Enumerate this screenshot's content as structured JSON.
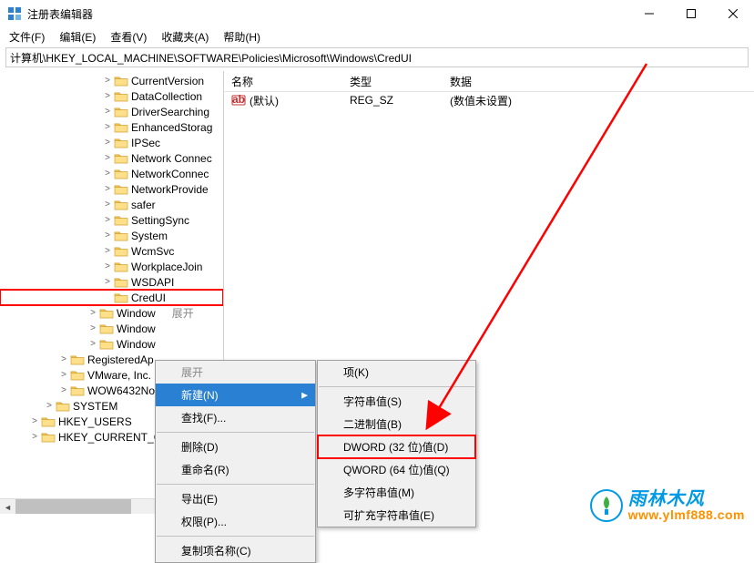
{
  "window": {
    "title": "注册表编辑器",
    "controls": {
      "min": "minimize",
      "max": "maximize",
      "close": "close"
    }
  },
  "menu": {
    "file": "文件(F)",
    "edit": "编辑(E)",
    "view": "查看(V)",
    "fav": "收藏夹(A)",
    "help": "帮助(H)"
  },
  "address": "计算机\\HKEY_LOCAL_MACHINE\\SOFTWARE\\Policies\\Microsoft\\Windows\\CredUI",
  "tree": {
    "items": [
      {
        "indent": 112,
        "exp": ">",
        "name": "CurrentVersion"
      },
      {
        "indent": 112,
        "exp": ">",
        "name": "DataCollection"
      },
      {
        "indent": 112,
        "exp": ">",
        "name": "DriverSearching"
      },
      {
        "indent": 112,
        "exp": ">",
        "name": "EnhancedStorag"
      },
      {
        "indent": 112,
        "exp": ">",
        "name": "IPSec"
      },
      {
        "indent": 112,
        "exp": ">",
        "name": "Network Connec"
      },
      {
        "indent": 112,
        "exp": ">",
        "name": "NetworkConnec"
      },
      {
        "indent": 112,
        "exp": ">",
        "name": "NetworkProvide"
      },
      {
        "indent": 112,
        "exp": ">",
        "name": "safer"
      },
      {
        "indent": 112,
        "exp": ">",
        "name": "SettingSync"
      },
      {
        "indent": 112,
        "exp": ">",
        "name": "System"
      },
      {
        "indent": 112,
        "exp": ">",
        "name": "WcmSvc"
      },
      {
        "indent": 112,
        "exp": ">",
        "name": "WorkplaceJoin"
      },
      {
        "indent": 112,
        "exp": ">",
        "name": "WSDAPI"
      },
      {
        "indent": 112,
        "exp": "",
        "name": "CredUI",
        "hl": true
      },
      {
        "indent": 96,
        "exp": ">",
        "name": "Window",
        "extra": "展开"
      },
      {
        "indent": 96,
        "exp": ">",
        "name": "Window"
      },
      {
        "indent": 96,
        "exp": ">",
        "name": "Window"
      },
      {
        "indent": 64,
        "exp": ">",
        "name": "RegisteredAp"
      },
      {
        "indent": 64,
        "exp": ">",
        "name": "VMware, Inc."
      },
      {
        "indent": 64,
        "exp": ">",
        "name": "WOW6432No"
      },
      {
        "indent": 48,
        "exp": ">",
        "name": "SYSTEM"
      },
      {
        "indent": 32,
        "exp": ">",
        "name": "HKEY_USERS"
      },
      {
        "indent": 32,
        "exp": ">",
        "name": "HKEY_CURRENT_CO"
      }
    ]
  },
  "list": {
    "headers": {
      "name": "名称",
      "type": "类型",
      "data": "数据"
    },
    "rows": [
      {
        "name": "(默认)",
        "type": "REG_SZ",
        "data": "(数值未设置)"
      }
    ]
  },
  "context_menu": {
    "expand": "展开",
    "new": "新建(N)",
    "find": "查找(F)...",
    "delete": "删除(D)",
    "rename": "重命名(R)",
    "export": "导出(E)",
    "perm": "权限(P)...",
    "copykey": "复制项名称(C)"
  },
  "submenu": {
    "key": "项(K)",
    "string": "字符串值(S)",
    "binary": "二进制值(B)",
    "dword32": "DWORD (32 位)值(D)",
    "qword64": "QWORD (64 位)值(Q)",
    "multistr": "多字符串值(M)",
    "expstr": "可扩充字符串值(E)"
  },
  "watermark": {
    "top": "雨林木风",
    "bot": "www.ylmf888.com"
  }
}
